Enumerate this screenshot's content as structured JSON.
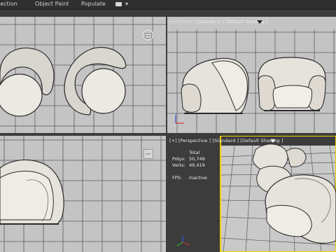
{
  "ribbon": {
    "tabs": [
      "lection",
      "Object Paint",
      "Populate"
    ],
    "dropdown_symbol": "▾"
  },
  "viewports": {
    "front": {
      "label": "[+] [Front ] [Standard ] [Default Shading ]"
    },
    "perspective": {
      "label": "[+] [Perspective ] [Standard ] [Default Shading ]",
      "stats": {
        "header": "Total",
        "polys_label": "Polys:",
        "polys_value": "50,749",
        "verts_label": "Verts:",
        "verts_value": "49,419",
        "fps_label": "FPS:",
        "fps_value": "Inactive"
      }
    }
  },
  "icons": {
    "viewcube": "viewcube-icon",
    "filter": "funnel-icon",
    "axis": "axis-tripod-icon"
  },
  "colors": {
    "viewport_bg": "#c4c4c4",
    "active_border": "#f0d000",
    "grid": "#5b5b5b",
    "sofa": "#eae7df",
    "axis_x": "#d23232",
    "axis_y": "#32b432",
    "axis_z": "#3250d2"
  }
}
